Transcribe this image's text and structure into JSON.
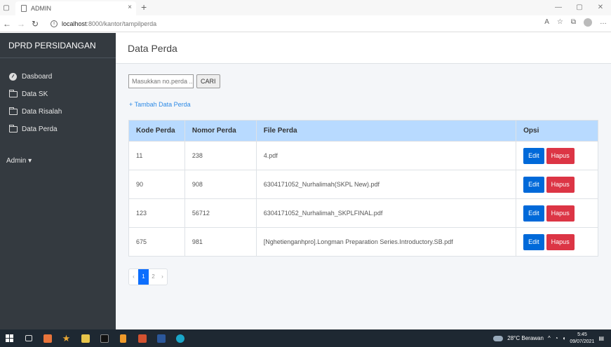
{
  "browser": {
    "tab_title": "ADMIN",
    "url_host": "localhost",
    "url_path": ":8000/kantor/tampilperda"
  },
  "sidebar": {
    "brand": "DPRD PERSIDANGAN",
    "items": [
      {
        "label": "Dasboard",
        "icon": "dashboard-icon"
      },
      {
        "label": "Data SK",
        "icon": "folder-icon"
      },
      {
        "label": "Data Risalah",
        "icon": "folder-icon"
      },
      {
        "label": "Data Perda",
        "icon": "folder-icon"
      }
    ],
    "admin_label": "Admin ▾"
  },
  "page": {
    "title": "Data Perda",
    "search_placeholder": "Masukkan no.perda ..",
    "search_button": "CARI",
    "add_link": "+ Tambah Data Perda"
  },
  "table": {
    "headers": [
      "Kode Perda",
      "Nomor Perda",
      "File Perda",
      "Opsi"
    ],
    "rows": [
      {
        "kode": "11",
        "nomor": "238",
        "file": "4.pdf"
      },
      {
        "kode": "90",
        "nomor": "908",
        "file": "6304171052_Nurhalimah(SKPL New).pdf"
      },
      {
        "kode": "123",
        "nomor": "56712",
        "file": "6304171052_Nurhalimah_SKPLFINAL.pdf"
      },
      {
        "kode": "675",
        "nomor": "981",
        "file": "[Nghetienganhpro].Longman Preparation Series.Introductory.SB.pdf"
      }
    ],
    "edit_label": "Edit",
    "delete_label": "Hapus"
  },
  "pagination": {
    "prev": "‹",
    "pages": [
      "1",
      "2"
    ],
    "next": "›",
    "active": "1"
  },
  "taskbar": {
    "weather": "28°C Berawan",
    "time": "5:45",
    "date": "09/07/2021"
  }
}
